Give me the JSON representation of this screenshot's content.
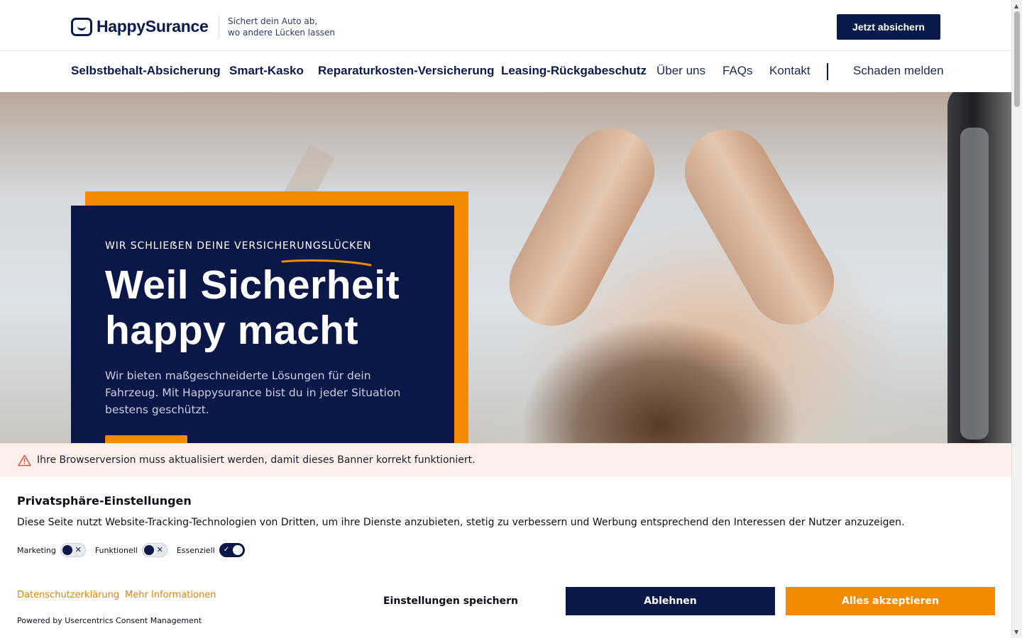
{
  "header": {
    "logo_text": "HappySurance",
    "tagline_line1": "Sichert dein Auto ab,",
    "tagline_line2": "wo andere Lücken lassen",
    "cta_label": "Jetzt absichern"
  },
  "nav": {
    "items": [
      {
        "label": "Selbstbehalt-Absicherung"
      },
      {
        "label": "Smart-Kasko"
      },
      {
        "label": "Reparaturkosten-Versicherung"
      },
      {
        "label": "Leasing-Rückgabeschutz"
      },
      {
        "label": "Über uns"
      },
      {
        "label": "FAQs"
      },
      {
        "label": "Kontakt"
      }
    ],
    "report_claim": "Schaden melden"
  },
  "hero": {
    "eyebrow": "WIR SCHLIEẞEN DEINE VERSICHERUNGSLÜCKEN",
    "headline_line1": "Weil Sicherheit",
    "headline_line2": "happy macht",
    "text": "Wir bieten maßgeschneiderte Lösungen für dein Fahrzeug. Mit Happysurance bist du in jeder Situation bestens geschützt."
  },
  "warning": {
    "text": "Ihre Browserversion muss aktualisiert werden, damit dieses Banner korrekt funktioniert."
  },
  "consent": {
    "title": "Privatsphäre-Einstellungen",
    "description": "Diese Seite nutzt Website-Tracking-Technologien von Dritten, um ihre Dienste anzubieten, stetig zu verbessern und Werbung entsprechend den Interessen der Nutzer anzuzeigen.",
    "toggles": [
      {
        "label": "Marketing",
        "enabled": false
      },
      {
        "label": "Funktionell",
        "enabled": false
      },
      {
        "label": "Essenziell",
        "enabled": true
      }
    ],
    "privacy_link": "Datenschutzerklärung",
    "more_info_link": "Mehr Informationen",
    "powered_by": "Powered by Usercentrics Consent Management",
    "save_label": "Einstellungen speichern",
    "deny_label": "Ablehnen",
    "accept_label": "Alles akzeptieren"
  },
  "colors": {
    "brand_navy": "#0b1847",
    "brand_orange": "#f38a00",
    "warning_bg": "#fdf0eb"
  },
  "icons": {
    "logo": "smile-box-icon",
    "warning": "warning-triangle-icon",
    "toggle_off": "close-icon",
    "toggle_on": "check-icon"
  }
}
